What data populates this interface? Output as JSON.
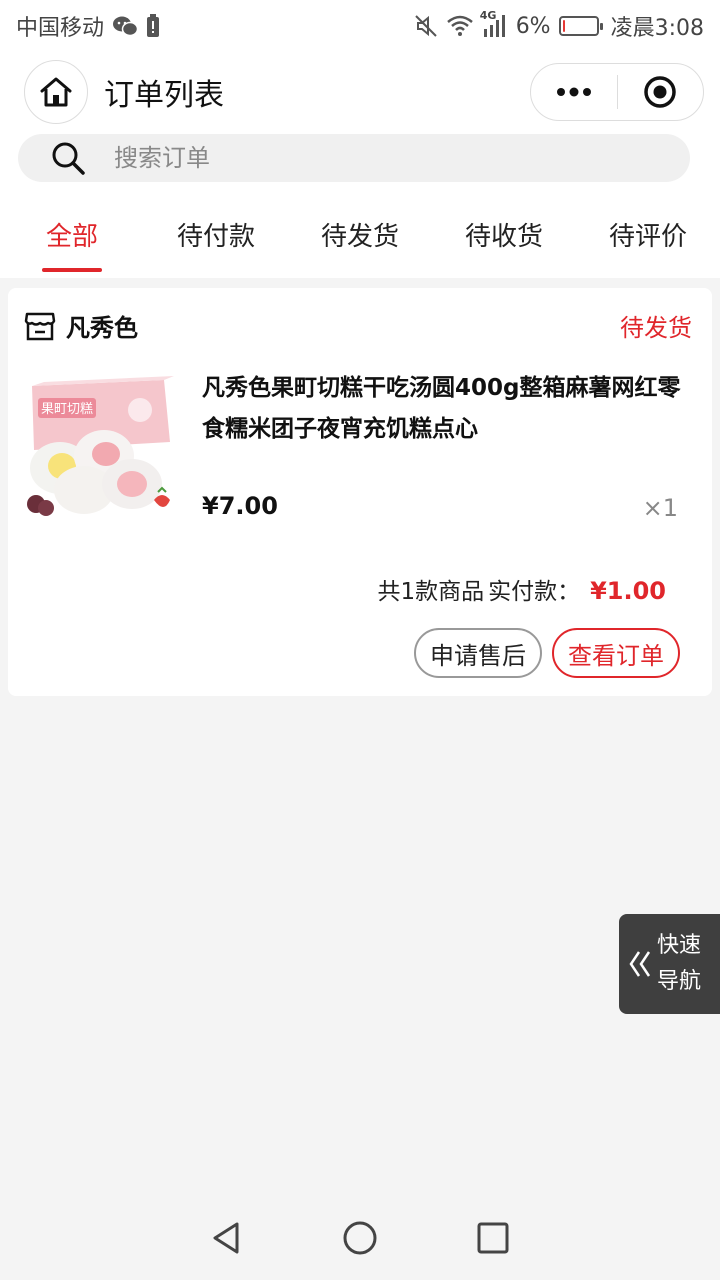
{
  "status_bar": {
    "carrier": "中国移动",
    "network": "4G",
    "battery_percent": "6%",
    "battery_level": 0.06,
    "time": "凌晨3:08"
  },
  "header": {
    "title": "订单列表",
    "icons": [
      "home-icon",
      "more-icon",
      "target-icon"
    ]
  },
  "search": {
    "placeholder": "搜索订单"
  },
  "tabs": [
    {
      "label": "全部",
      "active": true
    },
    {
      "label": "待付款",
      "active": false
    },
    {
      "label": "待发货",
      "active": false
    },
    {
      "label": "待收货",
      "active": false
    },
    {
      "label": "待评价",
      "active": false
    }
  ],
  "order": {
    "shop_name": "凡秀色",
    "status": "待发货",
    "product_title": "凡秀色果町切糕干吃汤圆400g整箱麻薯网红零食糯米团子夜宵充饥糕点心",
    "product_price": "¥7.00",
    "product_qty": "×1",
    "summary_count": "共1款商品",
    "summary_paid_label": "实付款：",
    "summary_total": "¥1.00",
    "buttons": {
      "after_sale": "申请售后",
      "view_order": "查看订单"
    },
    "image_box_text": "果町切糕"
  },
  "quick_nav": {
    "line1": "快速",
    "line2": "导航"
  },
  "colors": {
    "accent": "#e0262b",
    "background": "#f4f4f4"
  }
}
